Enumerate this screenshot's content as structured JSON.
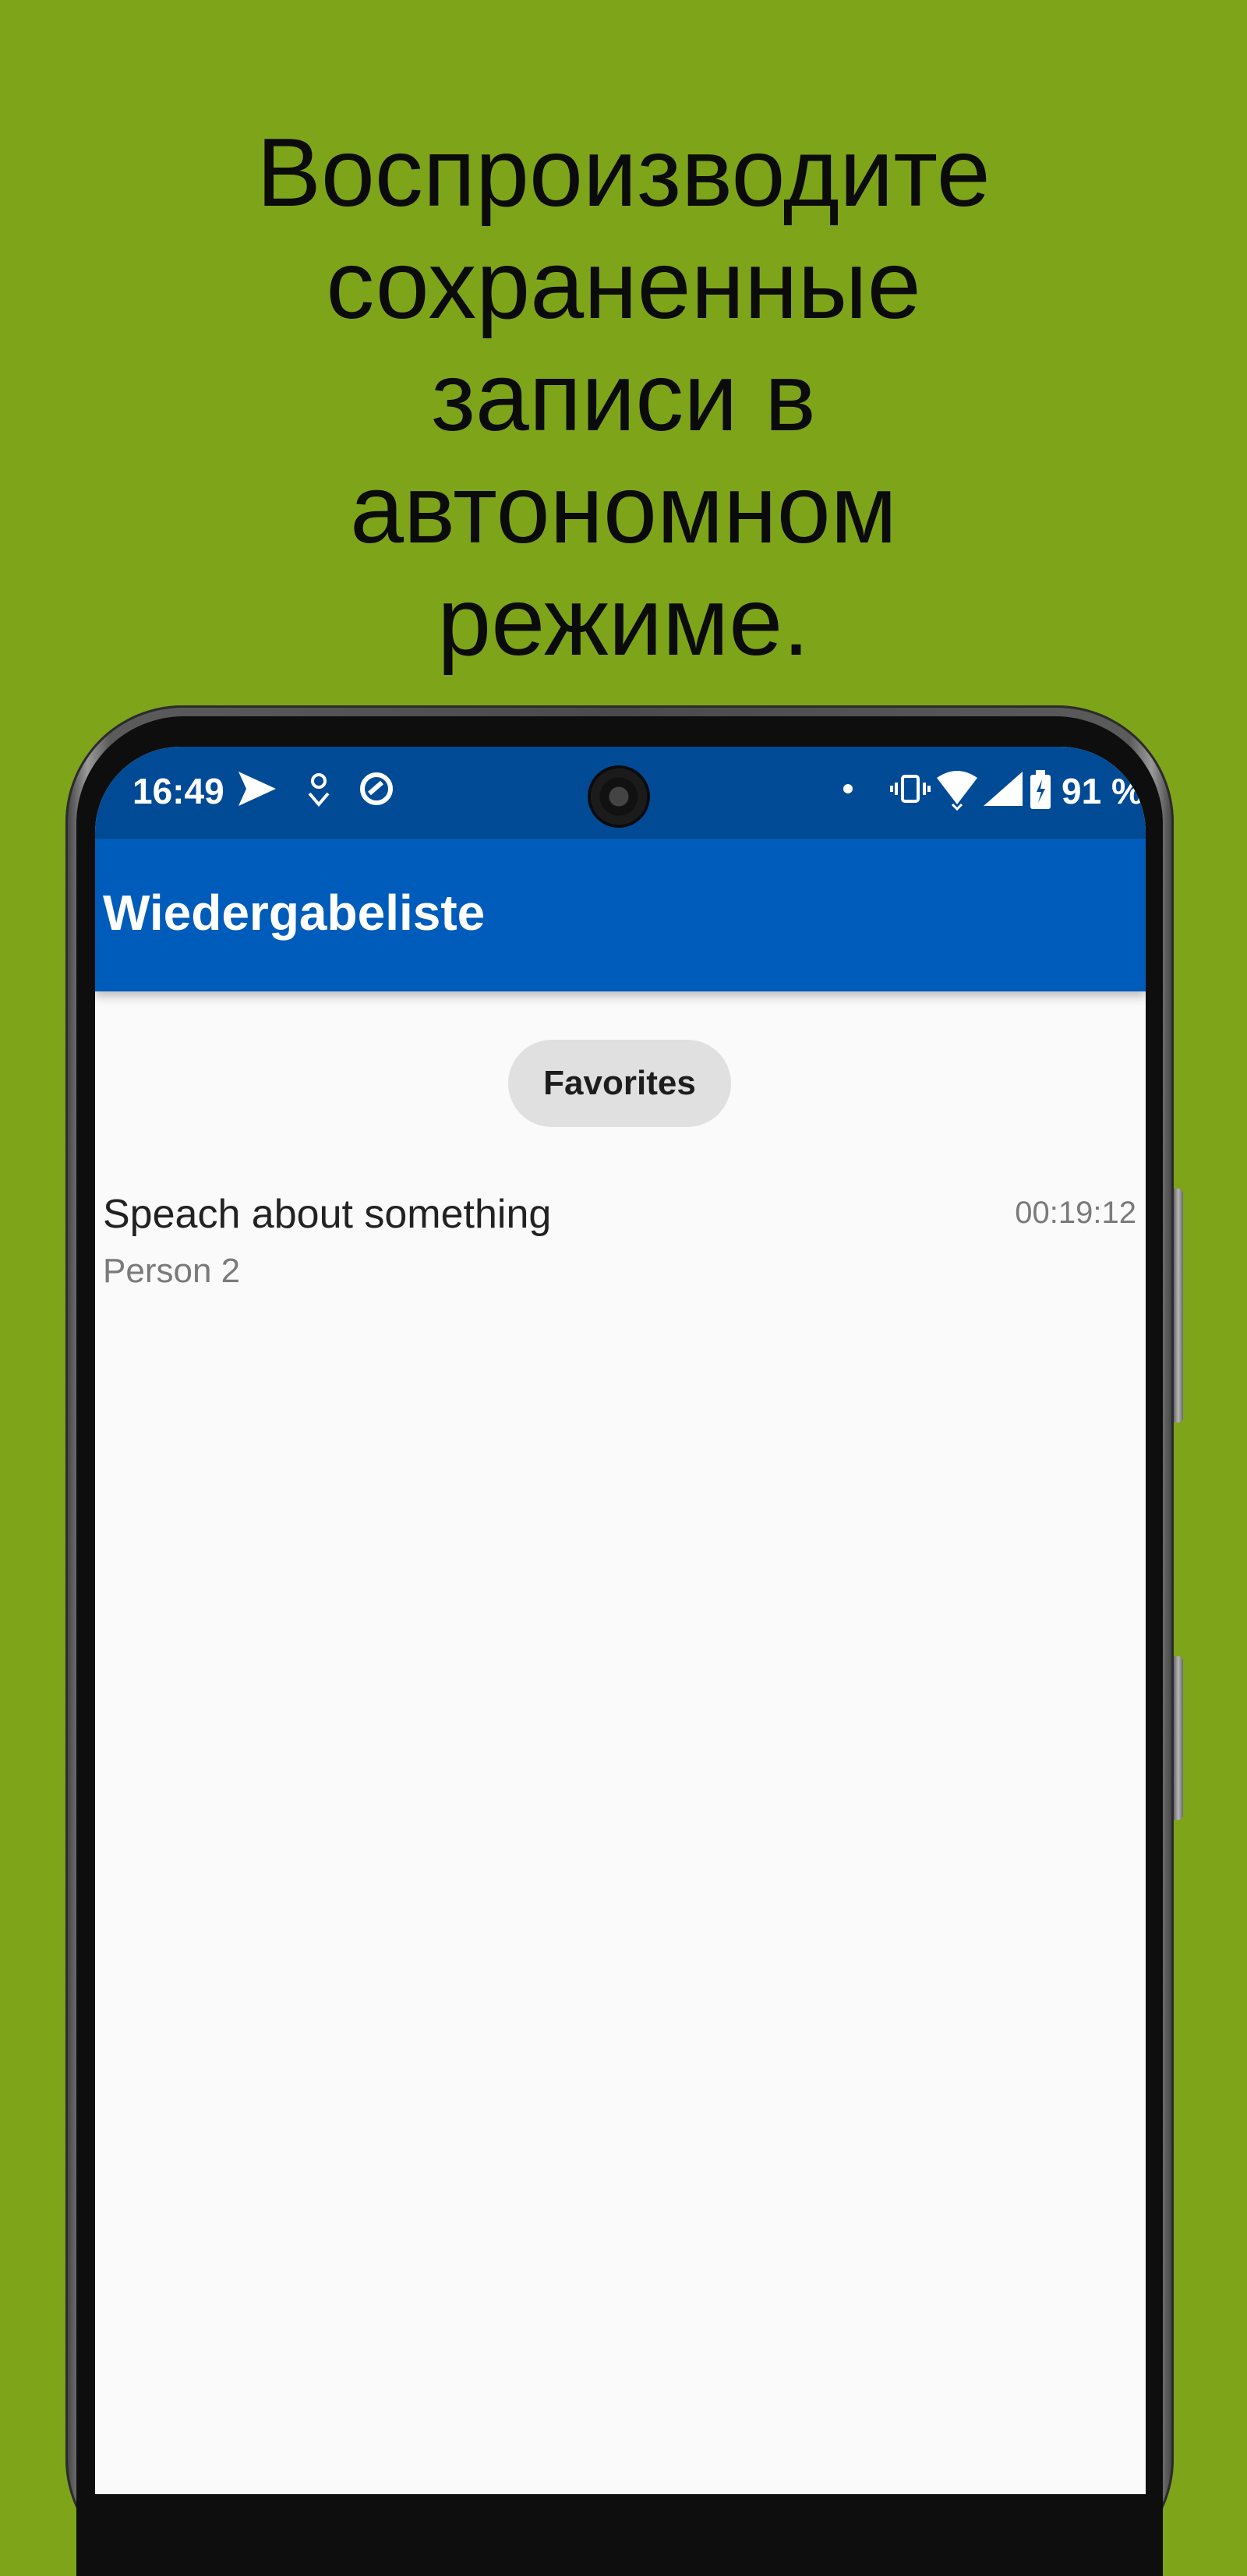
{
  "headline": {
    "lines": [
      "Воспроизводите",
      "сохраненные",
      "записи в",
      "автономном",
      "режиме."
    ]
  },
  "status_bar": {
    "time": "16:49",
    "battery": "91 %",
    "icons": [
      "send-icon",
      "location-pin-icon",
      "sync-icon",
      "dot-icon",
      "vibrate-icon",
      "wifi-icon",
      "signal-icon",
      "battery-icon"
    ]
  },
  "app_bar": {
    "title": "Wiedergabeliste"
  },
  "filter_chip": {
    "label": "Favorites"
  },
  "playlist": [
    {
      "title": "Speach about something",
      "subtitle": "Person 2",
      "duration": "00:19:12"
    }
  ],
  "colors": {
    "background": "#7ea41a",
    "status_bar": "#014b96",
    "app_bar": "#005cba",
    "screen": "#fafafa"
  }
}
